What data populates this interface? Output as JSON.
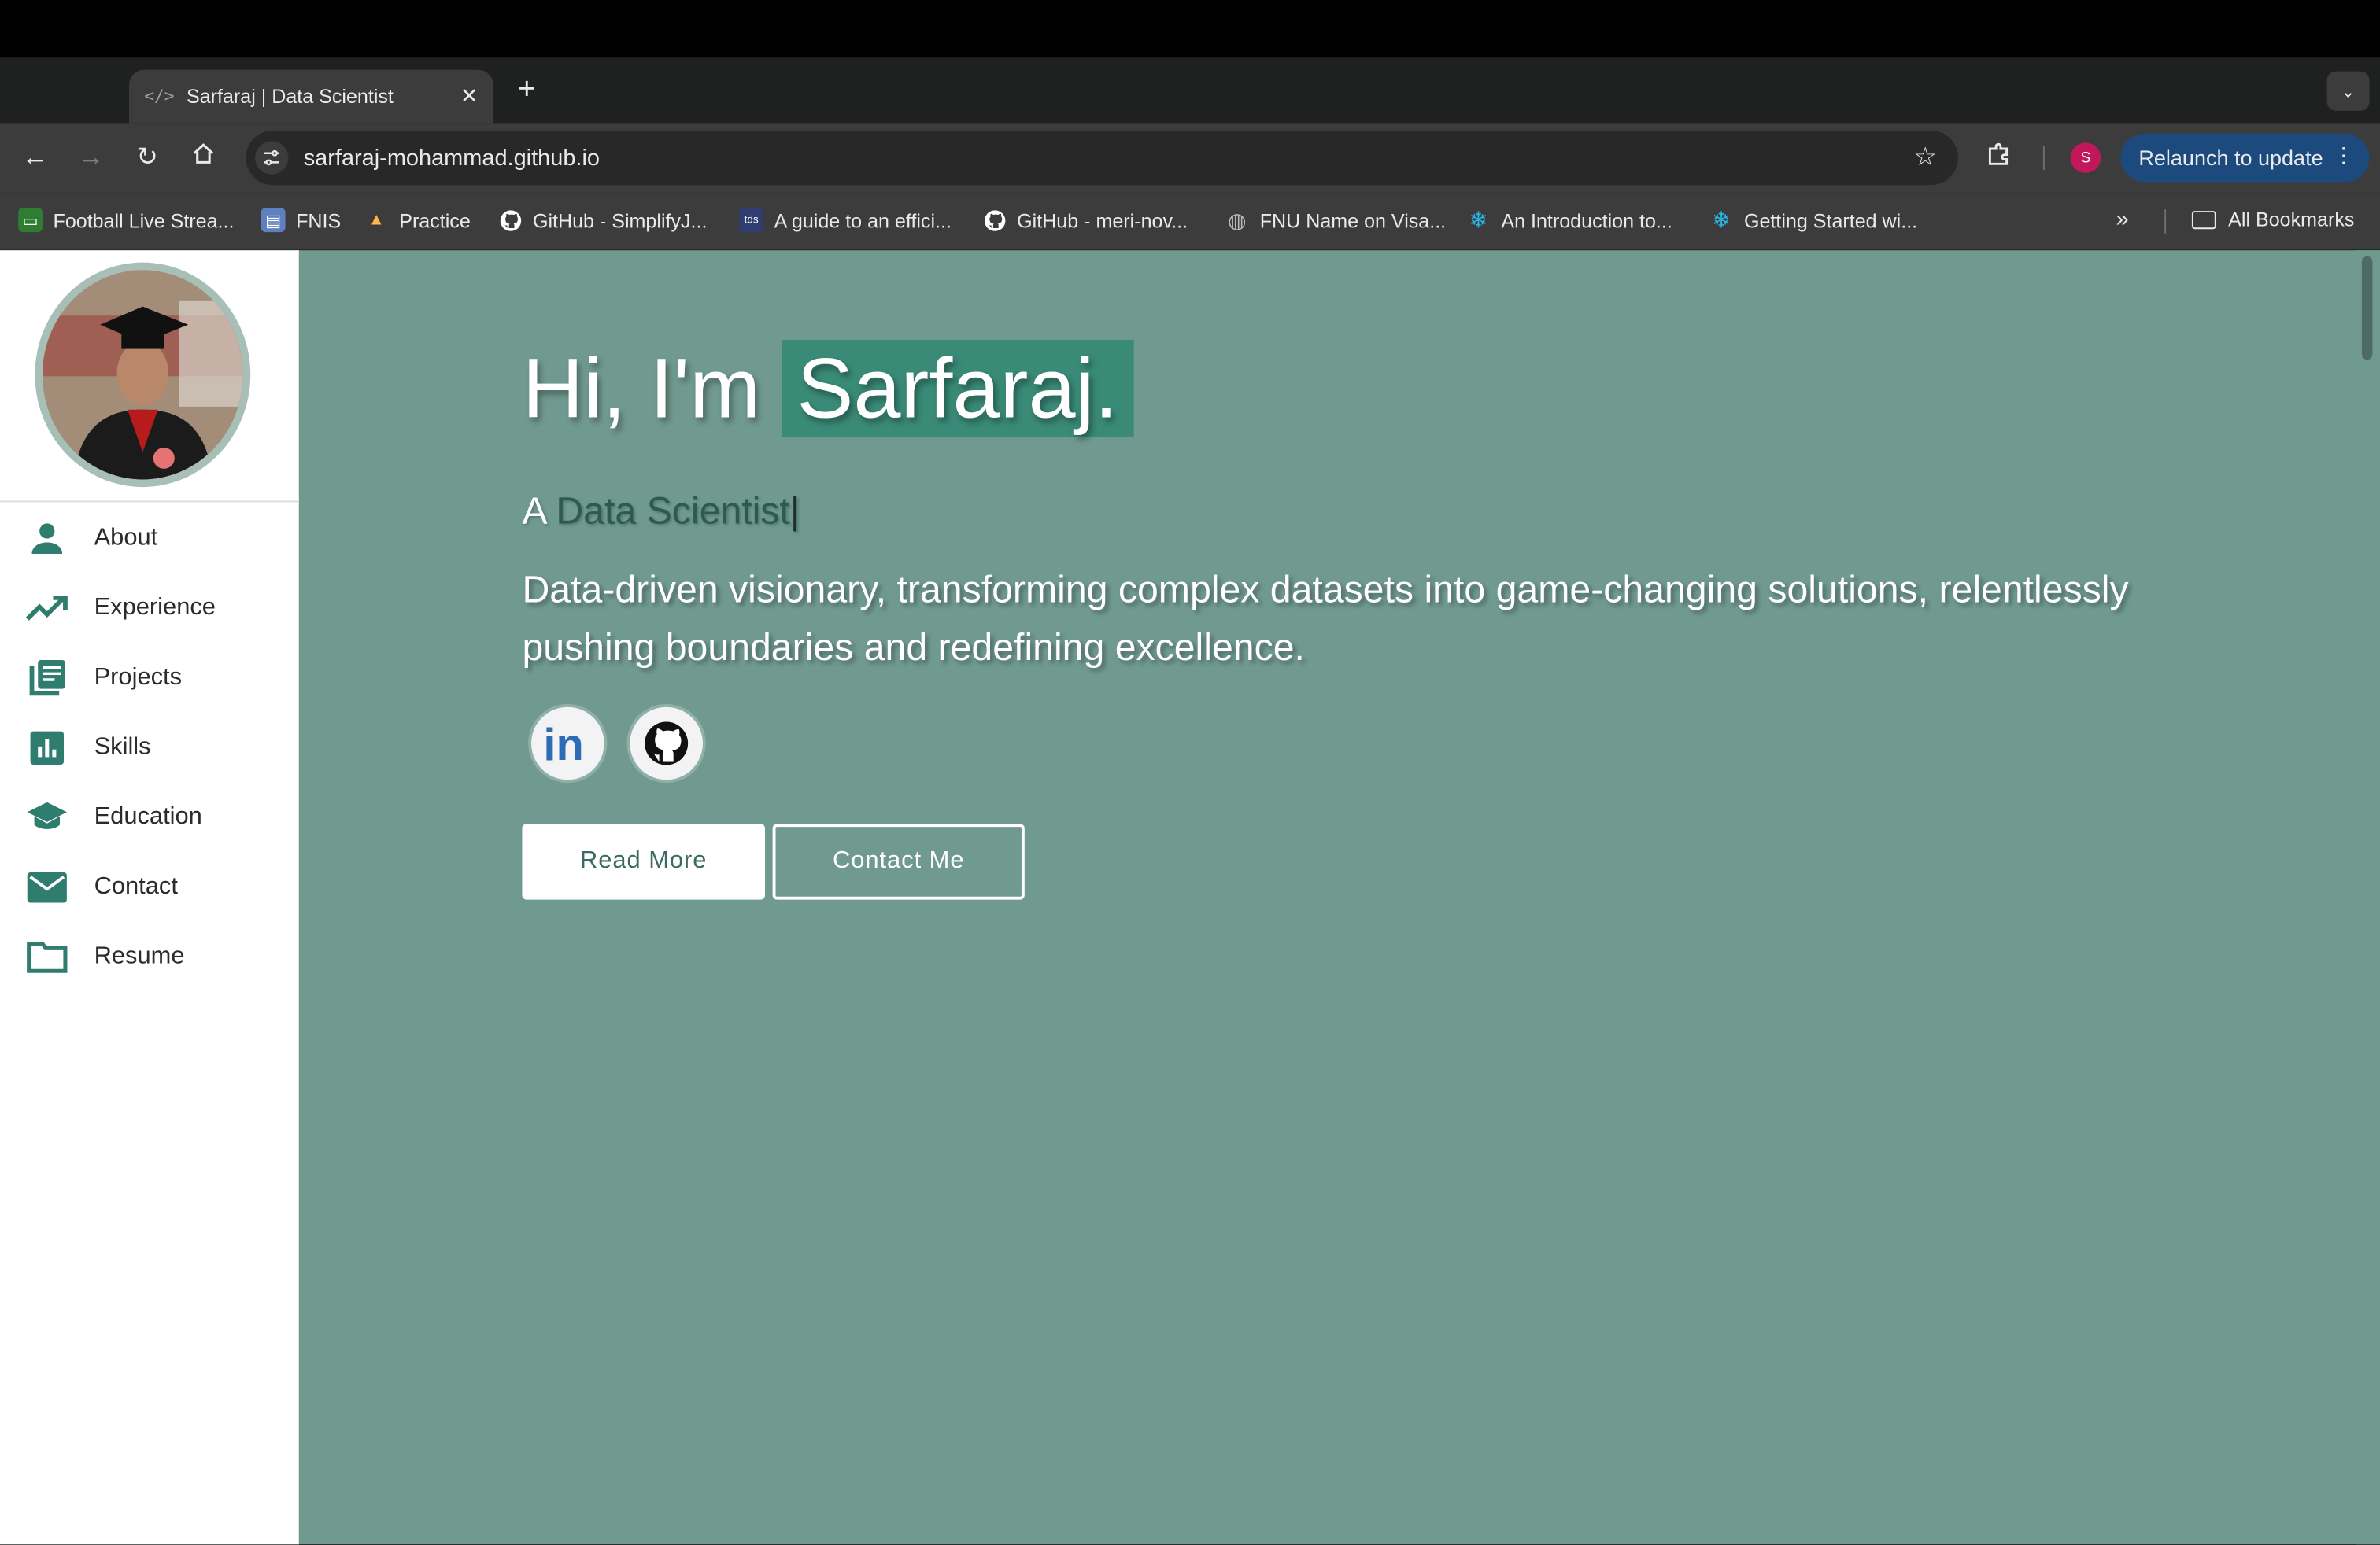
{
  "browser": {
    "tab_title": "Sarfaraj | Data Scientist",
    "tab_favicon": "</>",
    "url": "sarfaraj-mohammad.github.io",
    "profile_initial": "S",
    "relaunch_label": "Relaunch to update",
    "all_bookmarks_label": "All Bookmarks",
    "bookmarks": [
      {
        "label": "Football Live Strea...",
        "icon": "tv-icon",
        "color": "#4caf50"
      },
      {
        "label": "FNIS",
        "icon": "doc-icon",
        "color": "#8ab4f8"
      },
      {
        "label": "Practice",
        "icon": "rocket-icon",
        "color": "#ffcc80"
      },
      {
        "label": "GitHub - SimplifyJ...",
        "icon": "github-icon",
        "color": "#ffffff"
      },
      {
        "label": "A guide to an effici...",
        "icon": "tds-icon",
        "color": "#3a4a7a"
      },
      {
        "label": "GitHub - meri-nov...",
        "icon": "github-icon",
        "color": "#ffffff"
      },
      {
        "label": "FNU Name on Visa...",
        "icon": "globe-icon",
        "color": "#bdbdbd"
      },
      {
        "label": "An Introduction to...",
        "icon": "snowflake-icon",
        "color": "#29b5e8"
      },
      {
        "label": "Getting Started wi...",
        "icon": "snowflake-icon",
        "color": "#29b5e8"
      }
    ]
  },
  "sidebar": {
    "items": [
      {
        "label": "About",
        "icon": "person-icon"
      },
      {
        "label": "Experience",
        "icon": "trending-up-icon"
      },
      {
        "label": "Projects",
        "icon": "library-books-icon"
      },
      {
        "label": "Skills",
        "icon": "bar-chart-icon"
      },
      {
        "label": "Education",
        "icon": "school-icon"
      },
      {
        "label": "Contact",
        "icon": "mail-icon"
      },
      {
        "label": "Resume",
        "icon": "folder-icon"
      }
    ],
    "icon_color": "#2e7d6f"
  },
  "hero": {
    "greeting": "Hi, I'm",
    "name": "Sarfaraj.",
    "subtitle_prefix": "A",
    "role": "Data Scientist",
    "caret": "|",
    "description": "Data-driven visionary, transforming complex datasets into game-changing solutions, relentlessly pushing boundaries and redefining excellence.",
    "read_more": "Read More",
    "contact_me": "Contact Me",
    "social": [
      {
        "name": "linkedin",
        "glyph": "in"
      },
      {
        "name": "github",
        "glyph": ""
      }
    ]
  },
  "colors": {
    "page_bg": "#709a90",
    "name_highlight": "#3a8a78",
    "accent_dark": "#2e7d6f"
  }
}
